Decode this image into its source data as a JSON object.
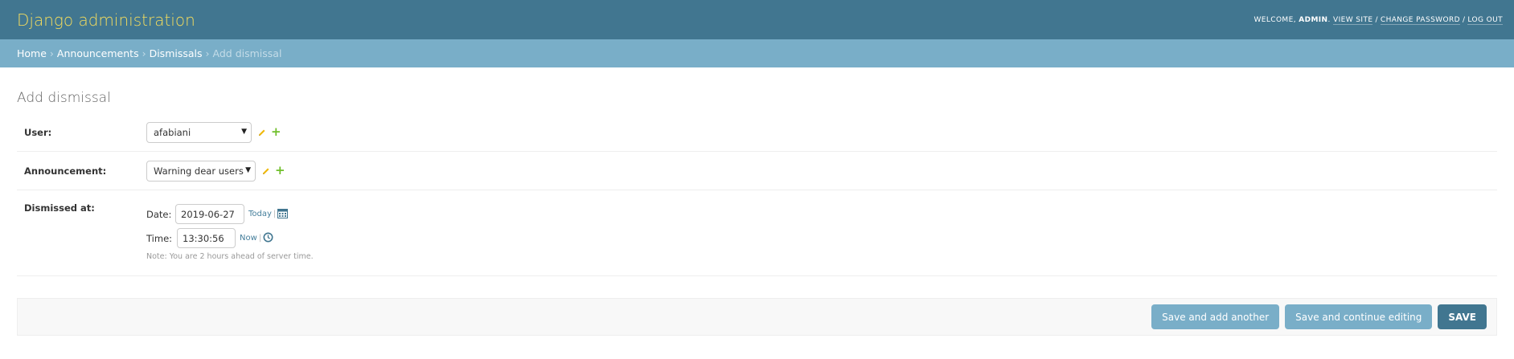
{
  "header": {
    "site_name": "Django administration",
    "welcome": "WELCOME,",
    "username": "ADMIN",
    "view_site": "VIEW SITE",
    "change_password": "CHANGE PASSWORD",
    "log_out": "LOG OUT"
  },
  "breadcrumbs": {
    "home": "Home",
    "app": "Announcements",
    "model": "Dismissals",
    "current": "Add dismissal"
  },
  "page": {
    "title": "Add dismissal"
  },
  "form": {
    "user": {
      "label": "User:",
      "value": "afabiani"
    },
    "announcement": {
      "label": "Announcement:",
      "value": "Warning dear users"
    },
    "dismissed_at": {
      "label": "Dismissed at:",
      "date_label": "Date:",
      "date_value": "2019-06-27",
      "today_link": "Today",
      "time_label": "Time:",
      "time_value": "13:30:56",
      "now_link": "Now",
      "note": "Note: You are 2 hours ahead of server time."
    }
  },
  "submit": {
    "save_add_another": "Save and add another",
    "save_continue": "Save and continue editing",
    "save": "SAVE"
  },
  "icons": {
    "edit": "pencil-icon",
    "add": "plus-icon",
    "calendar": "calendar-icon",
    "clock": "clock-icon",
    "dropdown": "chevron-down-icon"
  },
  "colors": {
    "header_bg": "#417690",
    "site_name": "#f5dd5d",
    "breadcrumbs_bg": "#79aec8",
    "add_green": "#70bf2b",
    "edit_yellow": "#efb80b"
  }
}
